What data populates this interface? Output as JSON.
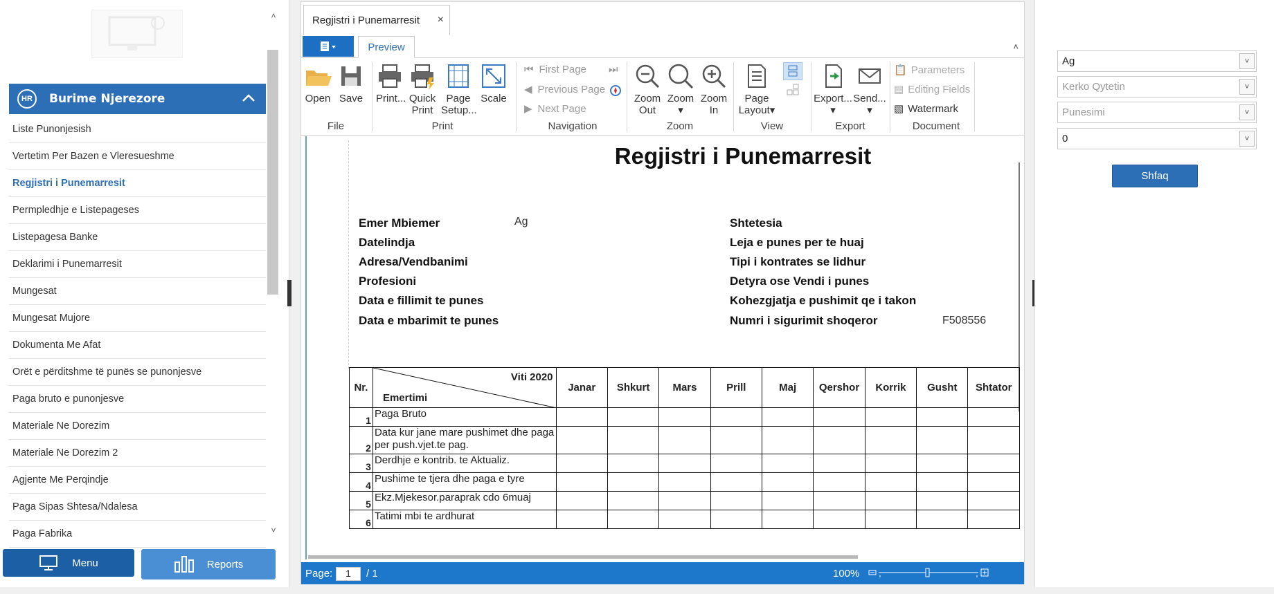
{
  "sidebar": {
    "header_badge": "HR",
    "header_title": "Burime Njerezore",
    "items": [
      {
        "label": "Liste Punonjesish"
      },
      {
        "label": "Vertetim Per Bazen e Vleresueshme"
      },
      {
        "label": "Regjistri i Punemarresit"
      },
      {
        "label": "Permpledhje e Listepageses"
      },
      {
        "label": "Listepagesa Banke"
      },
      {
        "label": "Deklarimi i Punemarresit"
      },
      {
        "label": "Mungesat"
      },
      {
        "label": "Mungesat Mujore"
      },
      {
        "label": "Dokumenta Me Afat"
      },
      {
        "label": "Orët e përditshme të punës se punonjesve"
      },
      {
        "label": "Paga bruto e punonjesve"
      },
      {
        "label": "Materiale Ne Dorezim"
      },
      {
        "label": "Materiale Ne Dorezim 2"
      },
      {
        "label": "Agjente Me Perqindje"
      },
      {
        "label": "Paga Sipas Shtesa/Ndalesa"
      },
      {
        "label": "Paga Fabrika"
      }
    ],
    "active_item": "Regjistri i Punemarresit",
    "menu_button": "Menu",
    "reports_button": "Reports"
  },
  "document": {
    "tab_title": "Regjistri i Punemarresit",
    "tab_close": "×",
    "ribbon_tab": "Preview",
    "ribbon": {
      "file": {
        "label": "File",
        "open": "Open",
        "save": "Save"
      },
      "print": {
        "label": "Print",
        "print": "Print...",
        "quick_print": [
          "Quick",
          "Print"
        ],
        "page_setup": [
          "Page",
          "Setup..."
        ],
        "scale": "Scale"
      },
      "navigation": {
        "label": "Navigation",
        "first_page": "First Page",
        "previous_page": "Previous Page",
        "next_page": "Next Page"
      },
      "zoom": {
        "label": "Zoom",
        "zoom_out": [
          "Zoom",
          "Out"
        ],
        "zoom": "Zoom",
        "zoom_in": [
          "Zoom",
          "In"
        ]
      },
      "view": {
        "label": "View",
        "page_layout": [
          "Page",
          "Layout"
        ]
      },
      "export": {
        "label": "Export",
        "export": "Export...",
        "send": "Send..."
      },
      "doc": {
        "label": "Document",
        "parameters": "Parameters",
        "editing_fields": "Editing Fields",
        "watermark": "Watermark"
      }
    }
  },
  "report": {
    "title": "Regjistri i Punemarresit",
    "left_fields": [
      {
        "label": "Emer Mbiemer",
        "value": "Ag"
      },
      {
        "label": "Datelindja",
        "value": ""
      },
      {
        "label": "Adresa/Vendbanimi",
        "value": ""
      },
      {
        "label": "Profesioni",
        "value": ""
      },
      {
        "label": "Data e fillimit te punes",
        "value": ""
      },
      {
        "label": "Data e mbarimit te punes",
        "value": ""
      }
    ],
    "right_fields": [
      {
        "label": "Shtetesia",
        "value": ""
      },
      {
        "label": "Leja e punes per te huaj",
        "value": ""
      },
      {
        "label": "Tipi i kontrates se lidhur",
        "value": ""
      },
      {
        "label": "Detyra ose Vendi i punes",
        "value": ""
      },
      {
        "label": "Kohezgjatja e pushimit qe i takon",
        "value": ""
      },
      {
        "label": "Numri i sigurimit shoqeror",
        "value": "F508556"
      }
    ],
    "table": {
      "nr_header": "Nr.",
      "year_label": "Viti  2020",
      "desc_header": "Emertimi",
      "months": [
        "Janar",
        "Shkurt",
        "Mars",
        "Prill",
        "Maj",
        "Qershor",
        "Korrik",
        "Gusht",
        "Shtator"
      ],
      "rows": [
        {
          "nr": "1",
          "desc": "Paga Bruto"
        },
        {
          "nr": "2",
          "desc": "Data kur jane mare pushimet dhe paga per push.vjet.te pag."
        },
        {
          "nr": "3",
          "desc": "Derdhje e kontrib. te Aktualiz."
        },
        {
          "nr": "4",
          "desc": "Pushime te tjera dhe paga e tyre"
        },
        {
          "nr": "5",
          "desc": "Ekz.Mjekesor.paraprak cdo 6muaj"
        },
        {
          "nr": "6",
          "desc": "Tatimi mbi te ardhurat"
        }
      ]
    }
  },
  "status": {
    "page_label": "Page:",
    "page_value": "1",
    "page_total": "/ 1",
    "zoom": "100%"
  },
  "filters": {
    "employee": "Ag",
    "city_placeholder": "Kerko Qytetin",
    "employment_placeholder": "Punesimi",
    "number": "0",
    "show_button": "Shfaq"
  },
  "colors": {
    "accent": "#2d6fb6",
    "status_bar": "#1d78cc",
    "menu_button": "#1d5fa5",
    "reports_button": "#4a8ed4"
  }
}
